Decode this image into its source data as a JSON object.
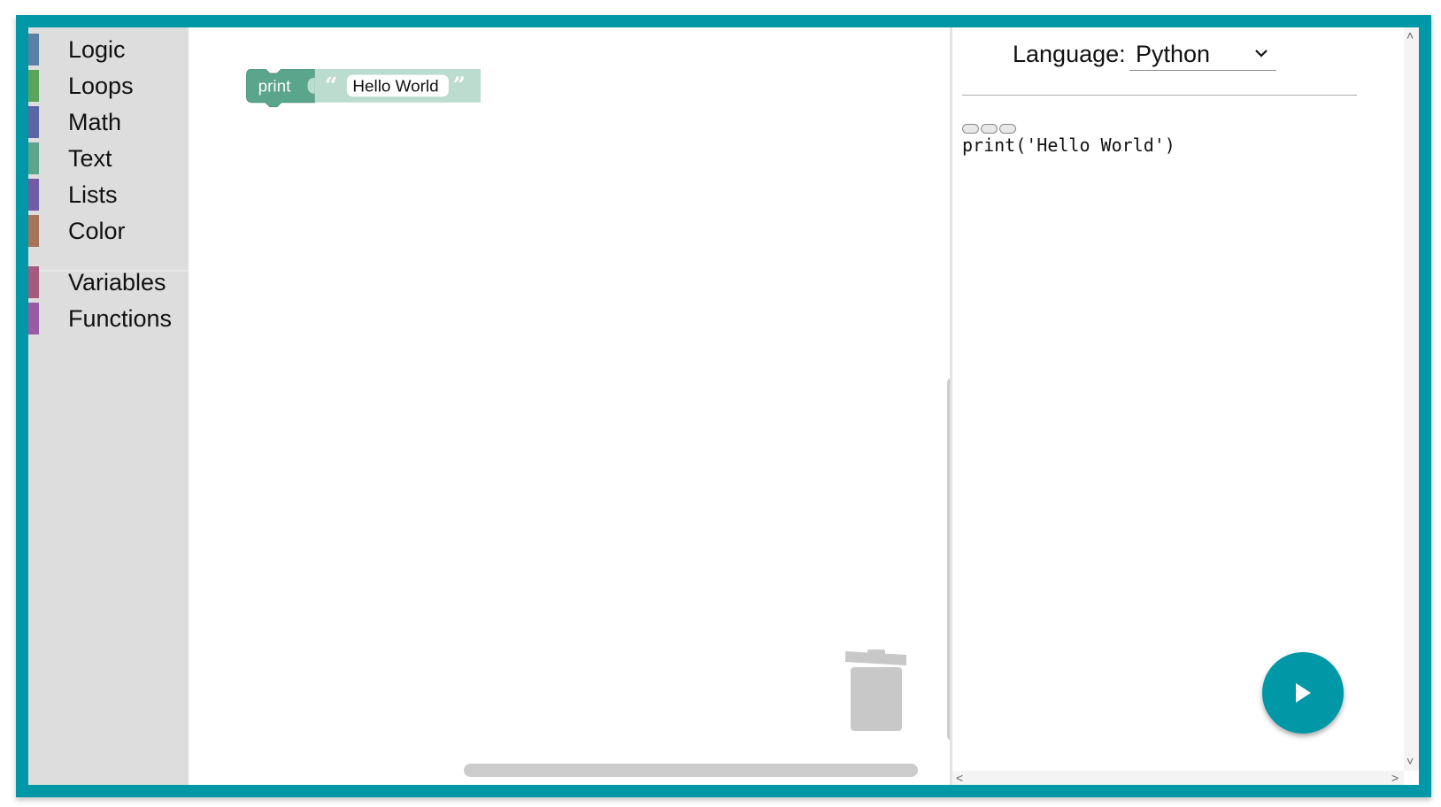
{
  "toolbox": {
    "categories": [
      {
        "label": "Logic",
        "color": "#5b80a5"
      },
      {
        "label": "Loops",
        "color": "#5ba55b"
      },
      {
        "label": "Math",
        "color": "#5b67a5"
      },
      {
        "label": "Text",
        "color": "#5ba58c"
      },
      {
        "label": "Lists",
        "color": "#745ba5"
      },
      {
        "label": "Color",
        "color": "#a5745b"
      },
      {
        "label": "Variables",
        "color": "#a55b80"
      },
      {
        "label": "Functions",
        "color": "#995ba5"
      }
    ]
  },
  "workspace": {
    "block": {
      "keyword": "print",
      "string_value": "Hello World",
      "open_quote": "“",
      "close_quote": "”",
      "color": "#5ba58c"
    }
  },
  "code_panel": {
    "language_label": "Language:",
    "language_value": "Python",
    "code": "print('Hello World')"
  },
  "theme": {
    "accent": "#0097a7"
  },
  "icons": {
    "trash": "trash-icon",
    "run": "play-icon",
    "dropdown": "chevron-down-icon"
  }
}
